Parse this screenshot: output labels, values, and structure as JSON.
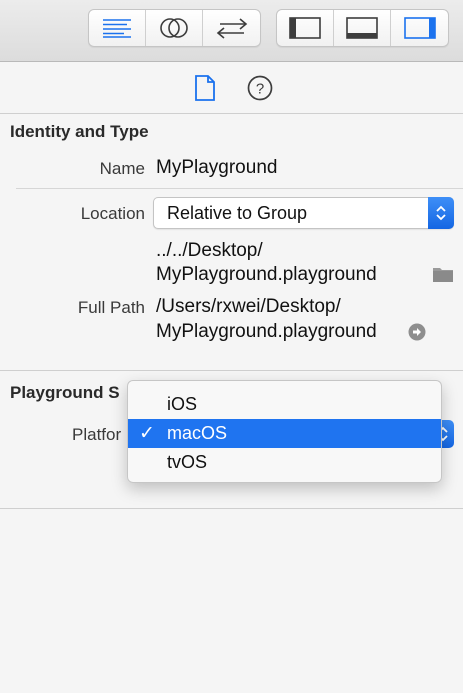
{
  "toolbar": {
    "editor_buttons": [
      {
        "name": "standard-editor-icon"
      },
      {
        "name": "assistant-editor-icon"
      },
      {
        "name": "version-editor-icon"
      }
    ],
    "view_buttons": [
      {
        "name": "navigator-toggle-icon"
      },
      {
        "name": "debug-area-toggle-icon"
      },
      {
        "name": "utilities-toggle-icon"
      }
    ]
  },
  "inspector_tabs": [
    {
      "name": "file-inspector-icon"
    },
    {
      "name": "quick-help-icon",
      "glyph": "?"
    }
  ],
  "identity": {
    "title": "Identity and Type",
    "name_label": "Name",
    "name_value": "MyPlayground",
    "location_label": "Location",
    "location_value": "Relative to Group",
    "location_path_line1": "../../Desktop/",
    "location_path_line2": "MyPlayground.playground",
    "full_path_label": "Full Path",
    "full_path_line1": "/Users/rxwei/Desktop/",
    "full_path_line2": "MyPlayground.playground"
  },
  "playground": {
    "title": "Playground S",
    "platform_label": "Platfor"
  },
  "platform_menu": {
    "items": [
      {
        "label": "iOS",
        "selected": false
      },
      {
        "label": "macOS",
        "selected": true
      },
      {
        "label": "tvOS",
        "selected": false
      }
    ],
    "check_glyph": "✓"
  },
  "colors": {
    "accent": "#1f74f0",
    "icon": "#3d3d3d"
  }
}
